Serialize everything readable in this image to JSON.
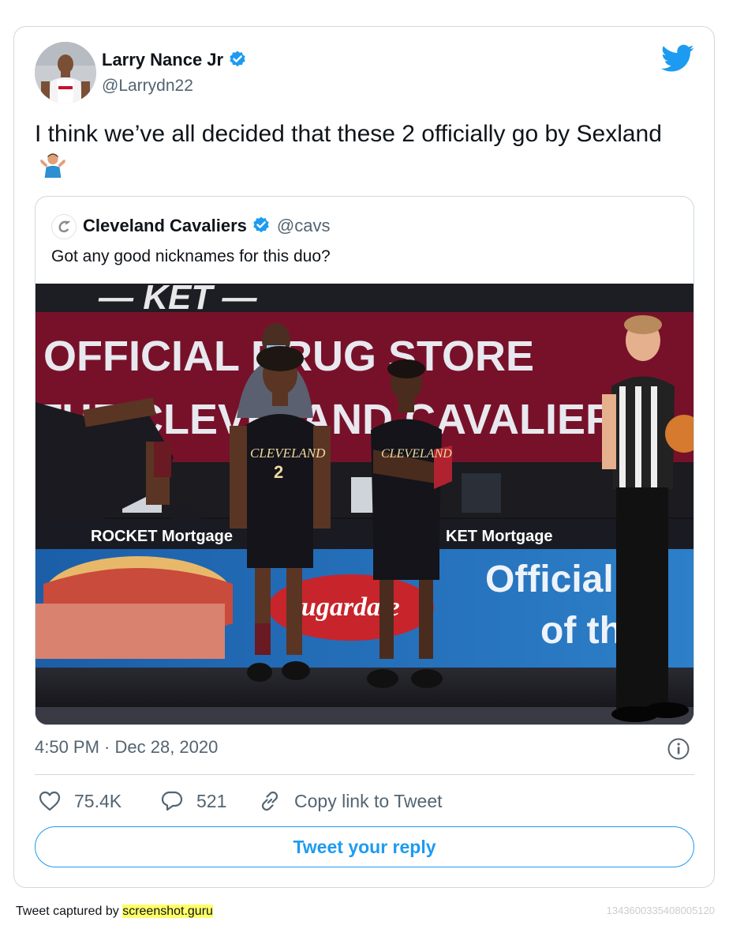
{
  "tweet": {
    "author": {
      "name": "Larry Nance Jr",
      "handle": "@Larrydn22",
      "verified": true,
      "avatar": "player-avatar"
    },
    "text": "I think we’ve all decided that these 2 officially go by Sexland",
    "emoji": "person-shrugging-emoji",
    "timestamp": "4:50 PM · Dec 28, 2020",
    "quoted": {
      "name": "Cleveland Cavaliers",
      "handle": "@cavs",
      "verified": true,
      "text": "Got any good nicknames for this duo?",
      "photo": {
        "banner_top": "OFFICIAL DRUG STORE",
        "banner_bottom": "THE CLEVELAND CAVALIERS",
        "board_text": "ROCKET Mortgage",
        "ad_text_line1": "Official",
        "ad_text_line2": "of the",
        "sugar_sign": "Sugardale",
        "jersey_text": "CLEVELAND",
        "jersey_number": "2"
      }
    }
  },
  "actions": {
    "likes": "75.4K",
    "replies": "521",
    "copy_link": "Copy link to Tweet"
  },
  "reply_button": "Tweet your reply",
  "footer": {
    "prefix": "Tweet captured by ",
    "site": "screenshot.guru",
    "tweet_id": "1343600335408005120"
  },
  "colors": {
    "accent": "#1d9bf0",
    "muted_text": "#536471",
    "border": "#cfd9de"
  }
}
